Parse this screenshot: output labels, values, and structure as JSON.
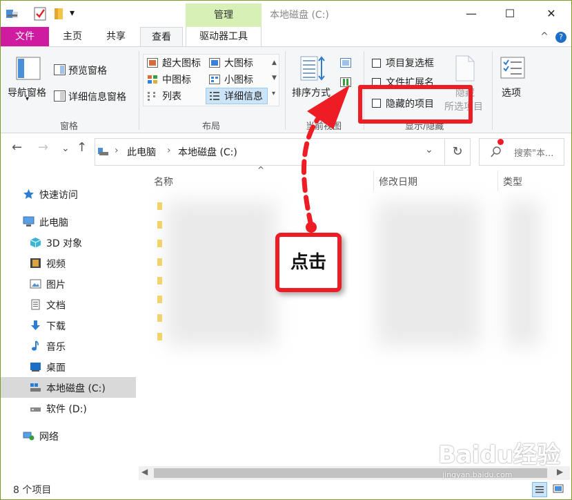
{
  "window": {
    "title": "本地磁盘 (C:)",
    "minimize": "—",
    "maximize": "☐",
    "close": "✕"
  },
  "quick_access_toolbar": {
    "dropdown": "▾"
  },
  "context_tab": {
    "label": "管理"
  },
  "ribbon_tabs": {
    "file": "文件",
    "home": "主页",
    "share": "共享",
    "view": "查看",
    "drive_tools": "驱动器工具",
    "collapse": "^",
    "help": "?"
  },
  "ribbon": {
    "panes": {
      "nav_pane": "导航窗格",
      "preview_pane": "预览窗格",
      "details_pane": "详细信息窗格",
      "group": "窗格"
    },
    "layout": {
      "extra_large": "超大图标",
      "large": "大图标",
      "medium": "中图标",
      "small": "小图标",
      "list": "列表",
      "details": "详细信息",
      "group": "布局"
    },
    "current_view": {
      "sort_by": "排序方式",
      "group": "当前视图"
    },
    "show_hide": {
      "item_checkboxes": "项目复选框",
      "file_extensions": "文件扩展名",
      "hidden_items": "隐藏的项目",
      "hide_selected_1": "隐藏",
      "hide_selected_2": "所选项目",
      "group": "显示/隐藏"
    },
    "options": {
      "label": "选项"
    }
  },
  "address_bar": {
    "crumb_1": "此电脑",
    "crumb_2": "本地磁盘 (C:)",
    "separator": "›"
  },
  "search": {
    "placeholder": "搜索\"本..."
  },
  "sidebar": {
    "items": [
      {
        "label": "快速访问"
      },
      {
        "label": "此电脑"
      },
      {
        "label": "3D 对象"
      },
      {
        "label": "视频"
      },
      {
        "label": "图片"
      },
      {
        "label": "文档"
      },
      {
        "label": "下载"
      },
      {
        "label": "音乐"
      },
      {
        "label": "桌面"
      },
      {
        "label": "本地磁盘 (C:)"
      },
      {
        "label": "软件 (D:)"
      },
      {
        "label": "网络"
      }
    ]
  },
  "columns": {
    "name": "名称",
    "modified": "修改日期",
    "type": "类型",
    "sort_arrow": "^"
  },
  "status_bar": {
    "item_count": "8 个项目"
  },
  "annotation": {
    "click_label": "点击"
  },
  "watermark": {
    "brand": "Baidu经验",
    "url": "jingyan.baidu.com"
  },
  "colors": {
    "file_tab": "#cf1b9f",
    "manage_tab": "#d6f0b6",
    "annotation_red": "#ee1c25",
    "selected_row": "#d9d9d9"
  }
}
